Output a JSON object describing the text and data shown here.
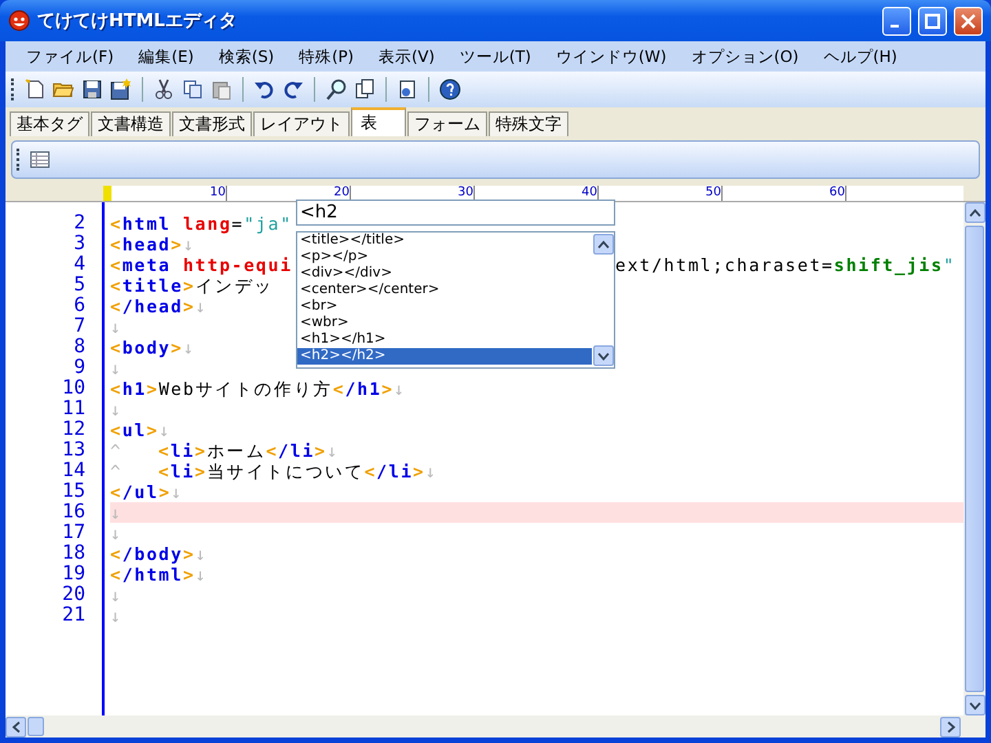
{
  "window": {
    "title": "てけてけHTMLエディタ"
  },
  "menu": [
    {
      "label": "ファイル(F)"
    },
    {
      "label": "編集(E)"
    },
    {
      "label": "検索(S)"
    },
    {
      "label": "特殊(P)"
    },
    {
      "label": "表示(V)"
    },
    {
      "label": "ツール(T)"
    },
    {
      "label": "ウインドウ(W)"
    },
    {
      "label": "オプション(O)"
    },
    {
      "label": "ヘルプ(H)"
    }
  ],
  "tabs": [
    {
      "label": "基本タグ",
      "selected": false
    },
    {
      "label": "文書構造",
      "selected": false
    },
    {
      "label": "文書形式",
      "selected": false
    },
    {
      "label": "レイアウト",
      "selected": false
    },
    {
      "label": "表",
      "selected": true
    },
    {
      "label": "フォーム",
      "selected": false
    },
    {
      "label": "特殊文字",
      "selected": false
    }
  ],
  "ruler": {
    "ticks": [
      "10",
      "20",
      "30",
      "40",
      "50",
      "60"
    ]
  },
  "editor": {
    "lines": [
      {
        "number": "2",
        "highlighted": false,
        "segments": [
          [
            {
              "kind": "bracket",
              "text": "<"
            },
            {
              "kind": "tag",
              "text": "html"
            },
            {
              "kind": "attr",
              "text": " lang"
            },
            {
              "kind": "text",
              "text": "="
            },
            {
              "kind": "str",
              "text": "\"ja\""
            }
          ]
        ]
      },
      {
        "number": "3",
        "highlighted": false,
        "segments": [
          [
            {
              "kind": "bracket",
              "text": "<"
            },
            {
              "kind": "tag",
              "text": "head"
            },
            {
              "kind": "bracket",
              "text": ">"
            },
            {
              "kind": "eol",
              "text": "↓"
            }
          ]
        ]
      },
      {
        "number": "4",
        "highlighted": false,
        "segments": [
          [
            {
              "kind": "bracket",
              "text": "<"
            },
            {
              "kind": "tag",
              "text": "meta"
            },
            {
              "kind": "attr",
              "text": " http-equi"
            }
          ],
          [
            {
              "kind": "text",
              "text": "ext/html;charaset="
            },
            {
              "kind": "val",
              "text": "shift_jis"
            },
            {
              "kind": "str",
              "text": "\""
            }
          ]
        ]
      },
      {
        "number": "5",
        "highlighted": false,
        "segments": [
          [
            {
              "kind": "bracket",
              "text": "<"
            },
            {
              "kind": "tag",
              "text": "title"
            },
            {
              "kind": "bracket",
              "text": ">"
            },
            {
              "kind": "text",
              "text": "インデッ"
            }
          ]
        ]
      },
      {
        "number": "6",
        "highlighted": false,
        "segments": [
          [
            {
              "kind": "bracket",
              "text": "<"
            },
            {
              "kind": "tag",
              "text": "/head"
            },
            {
              "kind": "bracket",
              "text": ">"
            },
            {
              "kind": "eol",
              "text": "↓"
            }
          ]
        ]
      },
      {
        "number": "7",
        "highlighted": false,
        "segments": [
          [
            {
              "kind": "eol",
              "text": "↓"
            }
          ]
        ]
      },
      {
        "number": "8",
        "highlighted": false,
        "segments": [
          [
            {
              "kind": "bracket",
              "text": "<"
            },
            {
              "kind": "tag",
              "text": "body"
            },
            {
              "kind": "bracket",
              "text": ">"
            },
            {
              "kind": "eol",
              "text": "↓"
            }
          ]
        ]
      },
      {
        "number": "9",
        "highlighted": false,
        "segments": [
          [
            {
              "kind": "eol",
              "text": "↓"
            }
          ]
        ]
      },
      {
        "number": "10",
        "highlighted": false,
        "segments": [
          [
            {
              "kind": "bracket",
              "text": "<"
            },
            {
              "kind": "tag",
              "text": "h1"
            },
            {
              "kind": "bracket",
              "text": ">"
            },
            {
              "kind": "text",
              "text": "Webサイトの作り方"
            },
            {
              "kind": "bracket",
              "text": "<"
            },
            {
              "kind": "tag",
              "text": "/h1"
            },
            {
              "kind": "bracket",
              "text": ">"
            },
            {
              "kind": "eol",
              "text": "↓"
            }
          ]
        ]
      },
      {
        "number": "11",
        "highlighted": false,
        "segments": [
          [
            {
              "kind": "eol",
              "text": "↓"
            }
          ]
        ]
      },
      {
        "number": "12",
        "highlighted": false,
        "segments": [
          [
            {
              "kind": "bracket",
              "text": "<"
            },
            {
              "kind": "tag",
              "text": "ul"
            },
            {
              "kind": "bracket",
              "text": ">"
            },
            {
              "kind": "eol",
              "text": "↓"
            }
          ]
        ]
      },
      {
        "number": "13",
        "highlighted": false,
        "segments": [
          [
            {
              "kind": "tab",
              "text": "^"
            },
            {
              "kind": "bracket",
              "text": "<"
            },
            {
              "kind": "tag",
              "text": "li"
            },
            {
              "kind": "bracket",
              "text": ">"
            },
            {
              "kind": "text",
              "text": "ホーム"
            },
            {
              "kind": "bracket",
              "text": "<"
            },
            {
              "kind": "tag",
              "text": "/li"
            },
            {
              "kind": "bracket",
              "text": ">"
            },
            {
              "kind": "eol",
              "text": "↓"
            }
          ]
        ]
      },
      {
        "number": "14",
        "highlighted": false,
        "segments": [
          [
            {
              "kind": "tab",
              "text": "^"
            },
            {
              "kind": "bracket",
              "text": "<"
            },
            {
              "kind": "tag",
              "text": "li"
            },
            {
              "kind": "bracket",
              "text": ">"
            },
            {
              "kind": "text",
              "text": "当サイトについて"
            },
            {
              "kind": "bracket",
              "text": "<"
            },
            {
              "kind": "tag",
              "text": "/li"
            },
            {
              "kind": "bracket",
              "text": ">"
            },
            {
              "kind": "eol",
              "text": "↓"
            }
          ]
        ]
      },
      {
        "number": "15",
        "highlighted": false,
        "segments": [
          [
            {
              "kind": "bracket",
              "text": "<"
            },
            {
              "kind": "tag",
              "text": "/ul"
            },
            {
              "kind": "bracket",
              "text": ">"
            },
            {
              "kind": "eol",
              "text": "↓"
            }
          ]
        ]
      },
      {
        "number": "16",
        "highlighted": true,
        "segments": [
          [
            {
              "kind": "eol",
              "text": "↓"
            }
          ]
        ]
      },
      {
        "number": "17",
        "highlighted": false,
        "segments": [
          [
            {
              "kind": "eol",
              "text": "↓"
            }
          ]
        ]
      },
      {
        "number": "18",
        "highlighted": false,
        "segments": [
          [
            {
              "kind": "bracket",
              "text": "<"
            },
            {
              "kind": "tag",
              "text": "/body"
            },
            {
              "kind": "bracket",
              "text": ">"
            },
            {
              "kind": "eol",
              "text": "↓"
            }
          ]
        ]
      },
      {
        "number": "19",
        "highlighted": false,
        "segments": [
          [
            {
              "kind": "bracket",
              "text": "<"
            },
            {
              "kind": "tag",
              "text": "/html"
            },
            {
              "kind": "bracket",
              "text": ">"
            },
            {
              "kind": "eol",
              "text": "↓"
            }
          ]
        ]
      },
      {
        "number": "20",
        "highlighted": false,
        "segments": [
          [
            {
              "kind": "eol",
              "text": "↓"
            }
          ]
        ]
      },
      {
        "number": "21",
        "highlighted": false,
        "segments": [
          [
            {
              "kind": "eol",
              "text": "↓"
            }
          ]
        ]
      }
    ]
  },
  "autocomplete": {
    "value": "<h2",
    "items": [
      {
        "label": "<title></title>",
        "selected": false
      },
      {
        "label": "<p></p>",
        "selected": false
      },
      {
        "label": "<div></div>",
        "selected": false
      },
      {
        "label": "<center></center>",
        "selected": false
      },
      {
        "label": "<br>",
        "selected": false
      },
      {
        "label": "<wbr>",
        "selected": false
      },
      {
        "label": "<h1></h1>",
        "selected": false
      },
      {
        "label": "<h2></h2>",
        "selected": true
      }
    ]
  }
}
